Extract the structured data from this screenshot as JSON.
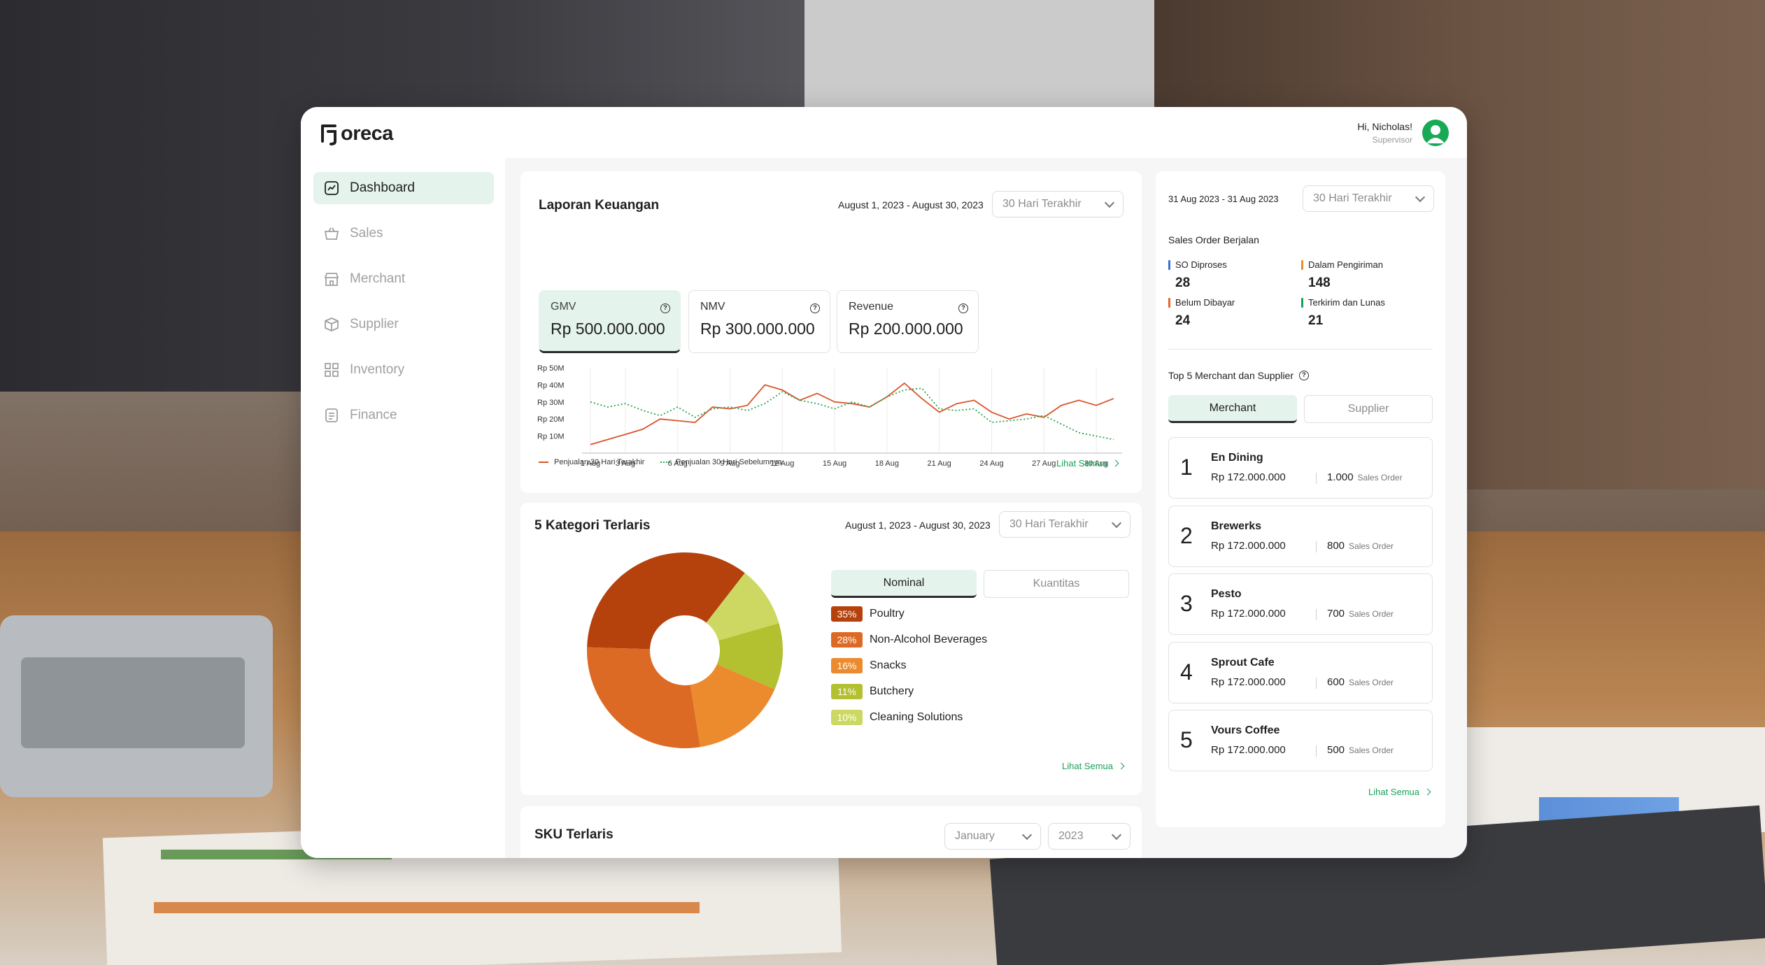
{
  "brand": {
    "name": "oreca"
  },
  "user": {
    "greeting": "Hi, Nicholas!",
    "role": "Supervisor"
  },
  "sidebar": {
    "items": [
      {
        "label": "Dashboard",
        "icon": "chart-icon",
        "active": true
      },
      {
        "label": "Sales",
        "icon": "basket-icon",
        "active": false
      },
      {
        "label": "Merchant",
        "icon": "store-icon",
        "active": false
      },
      {
        "label": "Supplier",
        "icon": "box-icon",
        "active": false
      },
      {
        "label": "Inventory",
        "icon": "grid-icon",
        "active": false
      },
      {
        "label": "Finance",
        "icon": "document-icon",
        "active": false
      }
    ]
  },
  "finance": {
    "title": "Laporan Keuangan",
    "date_range": "August 1, 2023 - August 30, 2023",
    "period": "30 Hari Terakhir",
    "metrics": [
      {
        "label": "GMV",
        "value": "Rp 500.000.000",
        "active": true
      },
      {
        "label": "NMV",
        "value": "Rp 300.000.000",
        "active": false
      },
      {
        "label": "Revenue",
        "value": "Rp 200.000.000",
        "active": false
      }
    ],
    "legend": {
      "current": "Penjualan 30 Hari Terakhir",
      "previous": "Penjualan 30 Hari Sebelumnya"
    },
    "see_all": "Lihat Semua"
  },
  "categories": {
    "title": "5 Kategori Terlaris",
    "date_range": "August 1, 2023 - August 30, 2023",
    "period": "30 Hari Terakhir",
    "tabs": [
      "Nominal",
      "Kuantitas"
    ],
    "items": [
      {
        "label": "Poultry",
        "pct": "35%",
        "value": 35,
        "color": "#b5410c"
      },
      {
        "label": "Non-Alcohol Beverages",
        "pct": "28%",
        "value": 28,
        "color": "#dc6a24"
      },
      {
        "label": "Snacks",
        "pct": "16%",
        "value": 16,
        "color": "#ec8a2e"
      },
      {
        "label": "Butchery",
        "pct": "11%",
        "value": 11,
        "color": "#b3c030"
      },
      {
        "label": "Cleaning Solutions",
        "pct": "10%",
        "value": 10,
        "color": "#cdd862"
      }
    ],
    "see_all": "Lihat Semua"
  },
  "sku": {
    "title": "SKU Terlaris",
    "month": "January",
    "year": "2023"
  },
  "summary": {
    "date_range": "31 Aug 2023 - 31 Aug 2023",
    "period": "30 Hari Terakhir",
    "so_title": "Sales Order Berjalan",
    "so_items": [
      {
        "label": "SO Diproses",
        "value": "28",
        "color": "#3d6fd6"
      },
      {
        "label": "Dalam Pengiriman",
        "value": "148",
        "color": "#ef8c2a"
      },
      {
        "label": "Belum Dibayar",
        "value": "24",
        "color": "#e5682a"
      },
      {
        "label": "Terkirim dan Lunas",
        "value": "21",
        "color": "#1aa05a"
      }
    ],
    "top_title": "Top 5 Merchant dan Supplier",
    "tabs": [
      "Merchant",
      "Supplier"
    ],
    "unit": "Sales Order",
    "merchants": [
      {
        "rank": "1",
        "name": "En Dining",
        "amount": "Rp 172.000.000",
        "count": "1.000"
      },
      {
        "rank": "2",
        "name": "Brewerks",
        "amount": "Rp 172.000.000",
        "count": "800"
      },
      {
        "rank": "3",
        "name": "Pesto",
        "amount": "Rp 172.000.000",
        "count": "700"
      },
      {
        "rank": "4",
        "name": "Sprout Cafe",
        "amount": "Rp 172.000.000",
        "count": "600"
      },
      {
        "rank": "5",
        "name": "Vours Coffee",
        "amount": "Rp 172.000.000",
        "count": "500"
      }
    ],
    "see_all": "Lihat Semua"
  },
  "chart_data": [
    {
      "type": "line",
      "title": "",
      "x_ticks": [
        "1 Aug",
        "3 Aug",
        "6 Aug",
        "9 Aug",
        "12 Aug",
        "15 Aug",
        "18 Aug",
        "21 Aug",
        "24 Aug",
        "27 Aug",
        "30 Aug"
      ],
      "y_ticks": [
        "Rp 10M",
        "Rp 20M",
        "Rp 30M",
        "Rp 40M",
        "Rp 50M"
      ],
      "ylim": [
        0,
        50
      ],
      "x": [
        1,
        2,
        3,
        4,
        5,
        6,
        7,
        8,
        9,
        10,
        11,
        12,
        13,
        14,
        15,
        16,
        17,
        18,
        19,
        20,
        21,
        22,
        23,
        24,
        25,
        26,
        27,
        28,
        29,
        30
      ],
      "series": [
        {
          "name": "Penjualan 30 Hari Terakhir",
          "color": "#d9542b",
          "style": "solid",
          "values": [
            5,
            8,
            11,
            14,
            20,
            19,
            18,
            27,
            26,
            28,
            40,
            37,
            31,
            35,
            30,
            29,
            27,
            33,
            41,
            32,
            24,
            29,
            31,
            24,
            20,
            23,
            21,
            28,
            31,
            28,
            32
          ]
        },
        {
          "name": "Penjualan 30 Hari Sebelumnya",
          "color": "#2aa44c",
          "style": "dotted",
          "values": [
            30,
            27,
            29,
            25,
            22,
            27,
            21,
            26,
            27,
            25,
            29,
            36,
            31,
            29,
            26,
            30,
            27,
            33,
            37,
            38,
            26,
            25,
            26,
            18,
            19,
            20,
            22,
            17,
            12,
            10,
            8
          ]
        }
      ]
    },
    {
      "type": "pie",
      "title": "",
      "categories": [
        "Poultry",
        "Non-Alcohol Beverages",
        "Snacks",
        "Butchery",
        "Cleaning Solutions"
      ],
      "values": [
        35,
        28,
        16,
        11,
        10
      ]
    }
  ]
}
